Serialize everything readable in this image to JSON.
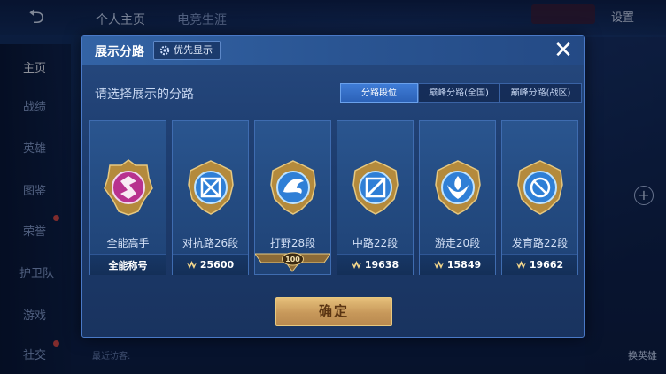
{
  "background": {
    "top_tabs": [
      "个人主页",
      "电竞生涯"
    ],
    "settings_label": "设置",
    "side_nav": [
      "主页",
      "战绩",
      "英雄",
      "图鉴",
      "荣誉",
      "护卫队",
      "游戏",
      "社交"
    ],
    "right_bottom_label": "换英雄",
    "bottom_label": "最近访客:"
  },
  "modal": {
    "title": "展示分路",
    "priority_label": "优先显示",
    "subtitle": "请选择展示的分路",
    "tabs": [
      {
        "label": "分路段位",
        "active": true
      },
      {
        "label": "巅峰分路(全国)",
        "active": false
      },
      {
        "label": "巅峰分路(战区)",
        "active": false
      }
    ],
    "cards": [
      {
        "title": "全能高手",
        "foot": "全能称号",
        "emblem": "all-round-emblem-icon",
        "color": "#b8328f"
      },
      {
        "title": "对抗路26段",
        "foot": "25600",
        "emblem": "clash-lane-emblem-icon",
        "color": "#2f7fd6"
      },
      {
        "title": "打野28段",
        "foot": "100",
        "emblem": "jungle-emblem-icon",
        "color": "#2f7fd6"
      },
      {
        "title": "中路22段",
        "foot": "19638",
        "emblem": "mid-lane-emblem-icon",
        "color": "#2f7fd6"
      },
      {
        "title": "游走20段",
        "foot": "15849",
        "emblem": "roam-emblem-icon",
        "color": "#2f7fd6"
      },
      {
        "title": "发育路22段",
        "foot": "19662",
        "emblem": "farm-lane-emblem-icon",
        "color": "#2f7fd6"
      }
    ],
    "confirm_label": "确定"
  }
}
